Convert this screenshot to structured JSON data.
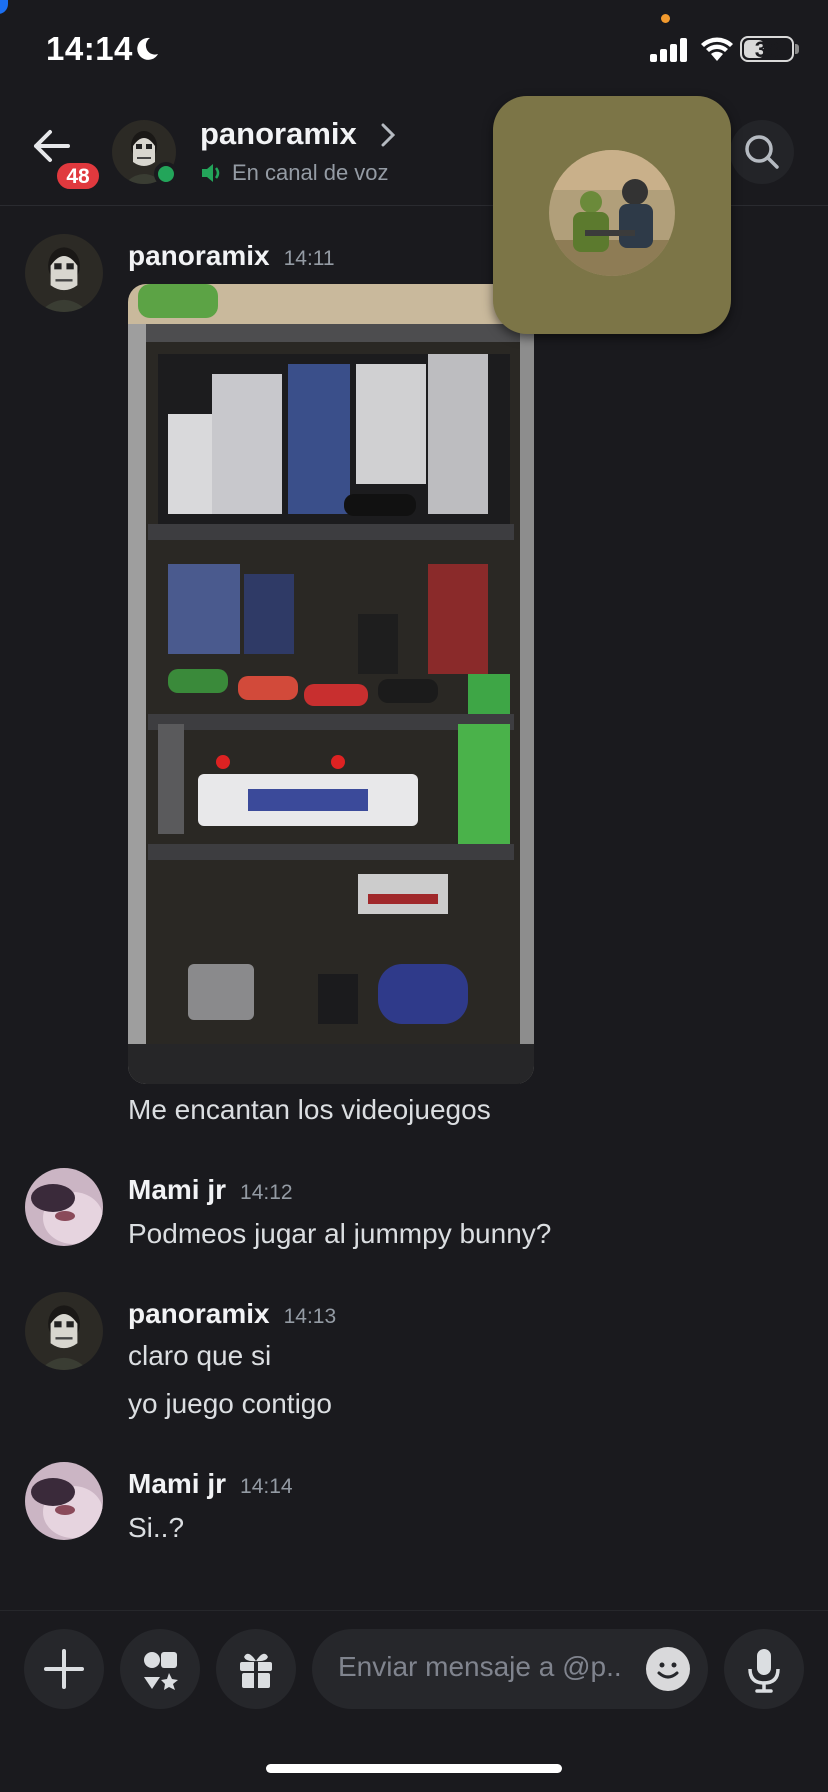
{
  "status_bar": {
    "time": "14:14",
    "battery": "38"
  },
  "header": {
    "badge_count": "48",
    "name": "panoramix",
    "subtitle": "En canal de voz"
  },
  "messages": [
    {
      "author": "panoramix",
      "time": "14:11",
      "lines": [
        "Me encantan los videojuegos"
      ],
      "has_image": true
    },
    {
      "author": "Mami jr",
      "time": "14:12",
      "lines": [
        "Podmeos jugar al jummpy bunny?"
      ]
    },
    {
      "author": "panoramix",
      "time": "14:13",
      "lines": [
        "claro que si",
        "yo juego contigo"
      ]
    },
    {
      "author": "Mami jr",
      "time": "14:14",
      "lines": [
        "Si..?"
      ]
    }
  ],
  "composer": {
    "placeholder": "Enviar mensaje a @p.."
  },
  "icons": {
    "back": "arrow-left-icon",
    "search": "search-icon",
    "speaker": "speaker-icon",
    "plus": "plus-icon",
    "apps": "apps-icon",
    "gift": "gift-icon",
    "emoji": "emoji-icon",
    "mic": "microphone-icon"
  },
  "colors": {
    "online": "#23a55a",
    "badge": "#e0393e",
    "voice_panel": "#7c7547"
  }
}
